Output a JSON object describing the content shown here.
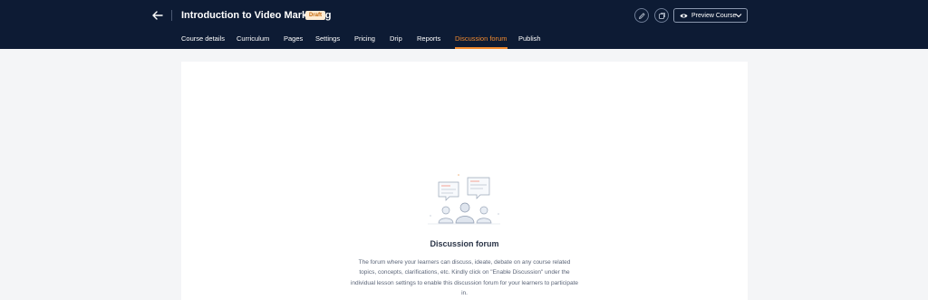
{
  "header": {
    "course_title": "Introduction to Video Marketing",
    "status_badge": "Draft",
    "preview_label": "Preview Course"
  },
  "icons": {
    "back": "arrow-left-icon",
    "edit": "pencil-icon",
    "copy": "copy-icon",
    "preview": "eye-icon",
    "dropdown": "chevron-down-icon"
  },
  "tabs": [
    {
      "label": "Course details"
    },
    {
      "label": "Curriculum"
    },
    {
      "label": "Pages"
    },
    {
      "label": "Settings"
    },
    {
      "label": "Pricing"
    },
    {
      "label": "Drip"
    },
    {
      "label": "Reports"
    },
    {
      "label": "Discussion forum",
      "active": true
    },
    {
      "label": "Publish"
    }
  ],
  "empty_state": {
    "title": "Discussion forum",
    "description": "The forum where your learners can discuss, ideate, debate on any course related topics, concepts, clarifications, etc. Kindly click on \"Enable Discussion\" under the individual lesson settings to enable this discussion forum for your learners to participate in."
  },
  "colors": {
    "header_bg": "#0d1b34",
    "accent": "#f28a2e",
    "page_bg": "#f4f5f7",
    "card_bg": "#ffffff",
    "badge_bg": "#fdebd3",
    "badge_text": "#c4670a"
  }
}
